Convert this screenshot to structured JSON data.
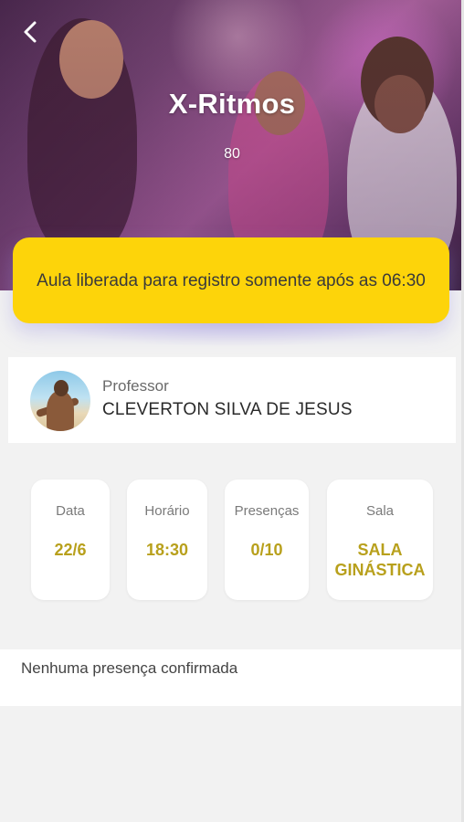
{
  "header": {
    "title": "X-Ritmos",
    "subtitle": "80",
    "back_icon": "chevron-left-icon"
  },
  "banner": {
    "text": "Aula liberada para registro somente após as 06:30",
    "color": "#fdd40a"
  },
  "professor": {
    "label": "Professor",
    "name": "CLEVERTON SILVA DE JESUS"
  },
  "stats": [
    {
      "label": "Data",
      "value": "22/6"
    },
    {
      "label": "Horário",
      "value": "18:30"
    },
    {
      "label": "Presenças",
      "value": "0/10"
    },
    {
      "label": "Sala",
      "value": "SALA GINÁSTICA"
    }
  ],
  "attendance": {
    "empty_text": "Nenhuma presença confirmada"
  },
  "colors": {
    "accent": "#b8a01c",
    "background": "#f2f2f2"
  }
}
